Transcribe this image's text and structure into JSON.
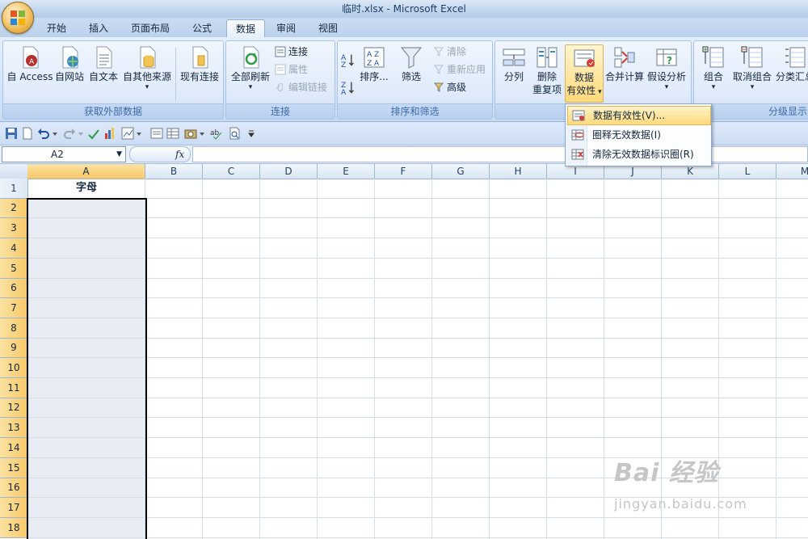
{
  "window": {
    "title": "临时.xlsx - Microsoft Excel"
  },
  "tabs": [
    "开始",
    "插入",
    "页面布局",
    "公式",
    "数据",
    "审阅",
    "视图"
  ],
  "active_tab": "数据",
  "ribbon": {
    "external_data": {
      "label": "获取外部数据",
      "access": "自 Access",
      "web": "自网站",
      "text": "自文本",
      "other": "自其他来源",
      "existing": "现有连接"
    },
    "connections": {
      "label": "连接",
      "refresh_all": "全部刷新",
      "connections": "连接",
      "properties": "属性",
      "edit_links": "编辑链接"
    },
    "sort_filter": {
      "label": "排序和筛选",
      "sort": "排序...",
      "filter": "筛选",
      "clear": "清除",
      "reapply": "重新应用",
      "advanced": "高级"
    },
    "data_tools": {
      "text_to_columns": "分列",
      "remove_dup_1": "删除",
      "remove_dup_2": "重复项",
      "validation_1": "数据",
      "validation_2": "有效性",
      "consolidate": "合并计算",
      "what_if": "假设分析"
    },
    "outline": {
      "label": "分级显示",
      "group": "组合",
      "ungroup": "取消组合",
      "subtotal": "分类汇总"
    }
  },
  "validation_menu": {
    "items": [
      "数据有效性(V)...",
      "圈释无效数据(I)",
      "清除无效数据标识圈(R)"
    ]
  },
  "formula_bar": {
    "name_box": "A2",
    "fx": "fx"
  },
  "sheet": {
    "columns": [
      "A",
      "B",
      "C",
      "D",
      "E",
      "F",
      "G",
      "H",
      "I",
      "J",
      "K",
      "L",
      "M"
    ],
    "rows": [
      "1",
      "2",
      "3",
      "4",
      "5",
      "6",
      "7",
      "8",
      "9",
      "10",
      "11",
      "12",
      "13",
      "14",
      "15",
      "16",
      "17",
      "18"
    ],
    "cell_A1": "字母"
  },
  "watermark": {
    "main": "Bai 经验",
    "sub": "jingyan.baidu.com"
  },
  "colors": {
    "accent": "#f7c867",
    "ribbon": "#d6e5f7",
    "selected_column": "#e8ecf5"
  }
}
